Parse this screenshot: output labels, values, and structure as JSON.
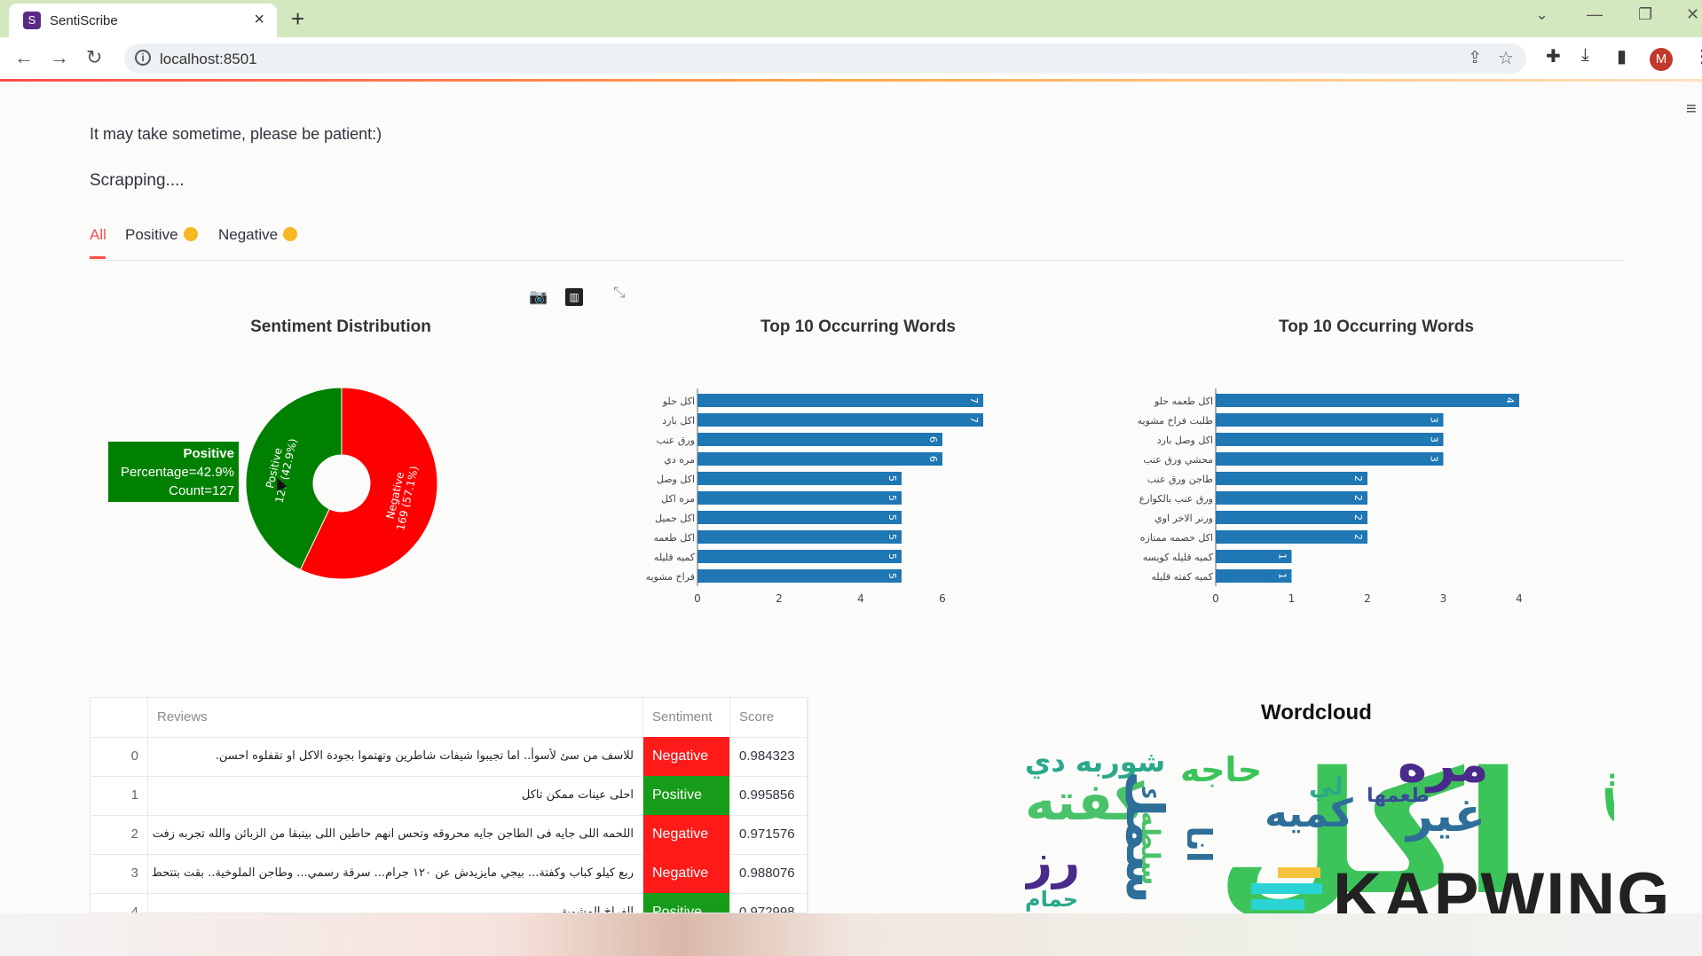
{
  "browser": {
    "tab_title": "SentiScribe",
    "url": "localhost:8501",
    "avatar_letter": "M"
  },
  "app": {
    "wait_text": "It may take sometime, please be patient:)",
    "status_text": "Scrapping....",
    "tabs": [
      "All",
      "Positive",
      "Negative"
    ],
    "active_tab": "All"
  },
  "charts": {
    "donut_title": "Sentiment Distribution",
    "bar1_title": "Top 10 Occurring Words",
    "bar2_title": "Top 10 Occurring Words",
    "tooltip": {
      "label": "Positive",
      "percentage": "Percentage=42.9%",
      "count": "Count=127"
    },
    "wordcloud_title": "Wordcloud"
  },
  "chart_data": [
    {
      "type": "pie",
      "title": "Sentiment Distribution",
      "slices": [
        {
          "label": "Negative",
          "value": 169,
          "percent": "57.1%",
          "color": "#ff0000",
          "text": "Negative\n169 (57.1%)"
        },
        {
          "label": "Positive",
          "value": 127,
          "percent": "42.9%",
          "color": "#008000",
          "text": "Positive\n127 (42.9%)"
        }
      ],
      "hole": true
    },
    {
      "type": "bar",
      "orientation": "horizontal",
      "title": "Top 10 Occurring Words",
      "categories": [
        "اكل حلو",
        "اكل بارد",
        "ورق عنب",
        "مره دي",
        "اكل وصل",
        "مره اكل",
        "اكل جميل",
        "اكل طعمه",
        "كميه قليله",
        "فراخ مشويه"
      ],
      "values": [
        7,
        7,
        6,
        6,
        5,
        5,
        5,
        5,
        5,
        5
      ],
      "xticks": [
        0,
        2,
        4,
        6
      ],
      "xlim": [
        0,
        7.5
      ],
      "color": "#1f77b4"
    },
    {
      "type": "bar",
      "orientation": "horizontal",
      "title": "Top 10 Occurring Words",
      "categories": [
        "اكل طعمه حلو",
        "طلبت فراخ مشويه",
        "اكل وصل بارد",
        "محشي ورق عنب",
        "طاجن ورق عنب",
        "ورق عنب بالكوارع",
        "ورنر الاخر اوي",
        "اكل خصمه ممتازه",
        "كميه قليله كويسه",
        "كميه كفته قليله"
      ],
      "values": [
        4,
        3,
        3,
        3,
        2,
        2,
        2,
        2,
        1,
        1
      ],
      "xticks": [
        0,
        1,
        2,
        3,
        4
      ],
      "xlim": [
        0,
        4
      ],
      "color": "#1f77b4"
    }
  ],
  "table": {
    "headers": [
      "",
      "Reviews",
      "Sentiment",
      "Score"
    ],
    "rows": [
      {
        "idx": "0",
        "review": "للاسف من سئ لأسوأ.. اما تجيبوا شيفات شاطرين وتهتموا بجودة الاكل او تقفلوه احسن.",
        "sentiment": "Negative",
        "score": "0.984323"
      },
      {
        "idx": "1",
        "review": "احلى عينات ممكن تاكل",
        "sentiment": "Positive",
        "score": "0.995856"
      },
      {
        "idx": "2",
        "review": "اللحمه اللى جايه فى الطاجن جايه محروقه وتحس انهم حاطين اللى بيتبقا من الزبائن والله تجربه زفت",
        "sentiment": "Negative",
        "score": "0.971576"
      },
      {
        "idx": "3",
        "review": "ربع كيلو كباب وكفتة... بيجي مايزيدش عن ١٢٠ جرام... سرقة رسمي... وطاجن الملوخية.. بقت بتتحط",
        "sentiment": "Negative",
        "score": "0.988076"
      },
      {
        "idx": "4",
        "review": "الفراخ المشوية ...",
        "sentiment": "Positive",
        "score": "0.972998"
      }
    ]
  },
  "wordcloud_words": [
    {
      "w": "اكل",
      "c": "#3cc45a"
    },
    {
      "w": "كفته",
      "c": "#49c26a"
    },
    {
      "w": "شوربه دي",
      "c": "#2aa88a"
    },
    {
      "w": "حاجه",
      "c": "#3cc45a"
    },
    {
      "w": "مره",
      "c": "#4a2a8a"
    },
    {
      "w": "كويس",
      "c": "#3cc45a"
    },
    {
      "w": "غير",
      "c": "#2e6f9a"
    },
    {
      "w": "كميه",
      "c": "#2e6f9a"
    },
    {
      "w": "رز",
      "c": "#4a2a8a"
    },
    {
      "w": "سمك",
      "c": "#2e6f9a"
    },
    {
      "w": "انا",
      "c": "#2e6f9a"
    },
    {
      "w": "طعمها",
      "c": "#3a4a9a"
    },
    {
      "w": "حمام",
      "c": "#2aa88a"
    },
    {
      "w": "سلطه",
      "c": "#49c26a"
    },
    {
      "w": "لي",
      "c": "#2aa88a"
    }
  ],
  "watermark": {
    "text": "KAPWING",
    "colors": [
      "#2ad4d4",
      "#f03c78",
      "#f6c43c"
    ]
  }
}
